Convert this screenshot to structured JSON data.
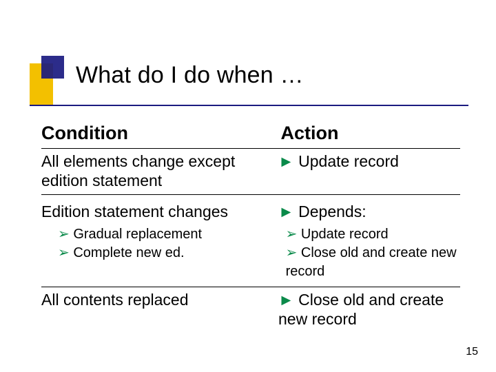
{
  "title": "What do I do when …",
  "headers": {
    "condition": "Condition",
    "action": "Action"
  },
  "rows": [
    {
      "condition": "All elements change except edition statement",
      "action_marker": "►",
      "action_text": "Update record"
    },
    {
      "condition": "Edition statement changes",
      "action_marker": "►",
      "action_text": "Depends:",
      "subs": [
        {
          "c_marker": "➢",
          "c_text": "Gradual replacement",
          "a_marker": "➢",
          "a_text": "Update record"
        },
        {
          "c_marker": "➢",
          "c_text": "Complete new ed.",
          "a_marker": "➢",
          "a_text": "Close old and create new record"
        }
      ]
    },
    {
      "condition": "All contents replaced",
      "action_marker": "►",
      "action_text": "Close old and create new record"
    }
  ],
  "page_number": "15"
}
